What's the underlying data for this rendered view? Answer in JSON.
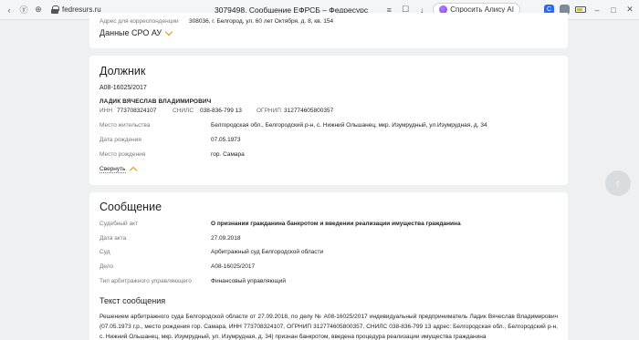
{
  "browser": {
    "url": "fedresurs.ru",
    "tab_title": "3079498. Сообщение ЕФРСБ – Федресурс",
    "alice_label": "Спросить Алису AI",
    "ext_blue_letter": "С"
  },
  "card1": {
    "corr_label": "Адрес для корреспонденции",
    "corr_value": "308036, г. Белгород, ул. 60 лет Октября, д. 8, кв. 154",
    "sro_label": "Данные СРО АУ"
  },
  "debtor": {
    "title": "Должник",
    "case_no": "А08-16025/2017",
    "name": "ЛАДИК ВЯЧЕСЛАВ ВЛАДИМИРОВИЧ",
    "inn_label": "ИНН",
    "inn": "773708324107",
    "snils_label": "СНИЛС",
    "snils": "038-836-799 13",
    "ogrnip_label": "ОГРНИП",
    "ogrnip": "312774605800357",
    "rows": [
      {
        "label": "Место жительства",
        "value": "Белгородская обл., Белгородский р-н, с. Нижний Ольшанец, мкр. Изумрудный, ул.Изумрудная, д. 34"
      },
      {
        "label": "Дата рождения",
        "value": "07.05.1973"
      },
      {
        "label": "Место рождения",
        "value": "гор. Самара"
      }
    ],
    "collapse_label": "Свернуть"
  },
  "message": {
    "title": "Сообщение",
    "rows": [
      {
        "label": "Судебный акт",
        "value": "О признании гражданина банкротом и введении реализации имущества гражданина"
      },
      {
        "label": "Дата акта",
        "value": "27.09.2018"
      },
      {
        "label": "Суд",
        "value": "Арбитражный суд Белгородской области"
      },
      {
        "label": "Дело",
        "value": "А08-16025/2017"
      },
      {
        "label": "Тип арбитражного управляющего",
        "value": "Финансовый управляющий"
      }
    ],
    "text_title": "Текст сообщения",
    "text": "Решением арбитражного суда Белгородской области от 27.09.2018, по делу № А08-16025/2017 индивидуальный предприниматель Ладик Вячеслав Владимирович (07.05.1973 г.р., место рождения гор. Самара, ИНН 773708324107, ОГРНИП 312774605800357, СНИЛС 038-836-799 13 адрес: Белгородская обл., Белгородский р-н, с. Нижний Ольшанец, мкр. Изумрудный, ул. Изумрудная, д. 34) признан банкротом, введена процедура реализации имущества гражданина"
  }
}
